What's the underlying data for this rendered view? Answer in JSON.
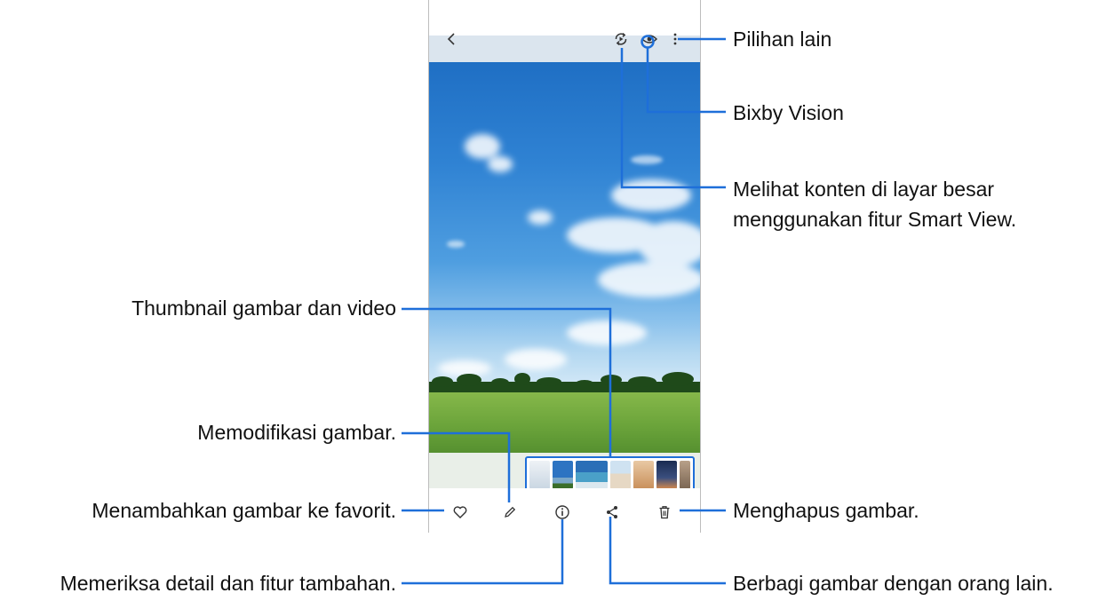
{
  "callouts": {
    "more_options": "Pilihan lain",
    "bixby_vision": "Bixby Vision",
    "smart_view_line1": "Melihat konten di layar besar",
    "smart_view_line2": "menggunakan fitur Smart View.",
    "thumbnails": "Thumbnail gambar dan video",
    "edit": "Memodifikasi gambar.",
    "favorite": "Menambahkan gambar ke favorit.",
    "details": "Memeriksa detail dan fitur tambahan.",
    "share": "Berbagi gambar dengan orang lain.",
    "delete": "Menghapus gambar."
  },
  "toolbar_top": {
    "icons": [
      "back-icon",
      "smart-view-icon",
      "bixby-vision-eye-icon",
      "more-options-icon"
    ]
  },
  "toolbar_bottom": {
    "icons": [
      "heart-icon",
      "pencil-icon",
      "info-icon",
      "share-icon",
      "trash-icon"
    ]
  },
  "thumbnails": {
    "count": 8,
    "selected_index": 2
  },
  "colors": {
    "accent": "#1e6fd9",
    "sky": "#2f82d3",
    "grass": "#6aa33a"
  }
}
